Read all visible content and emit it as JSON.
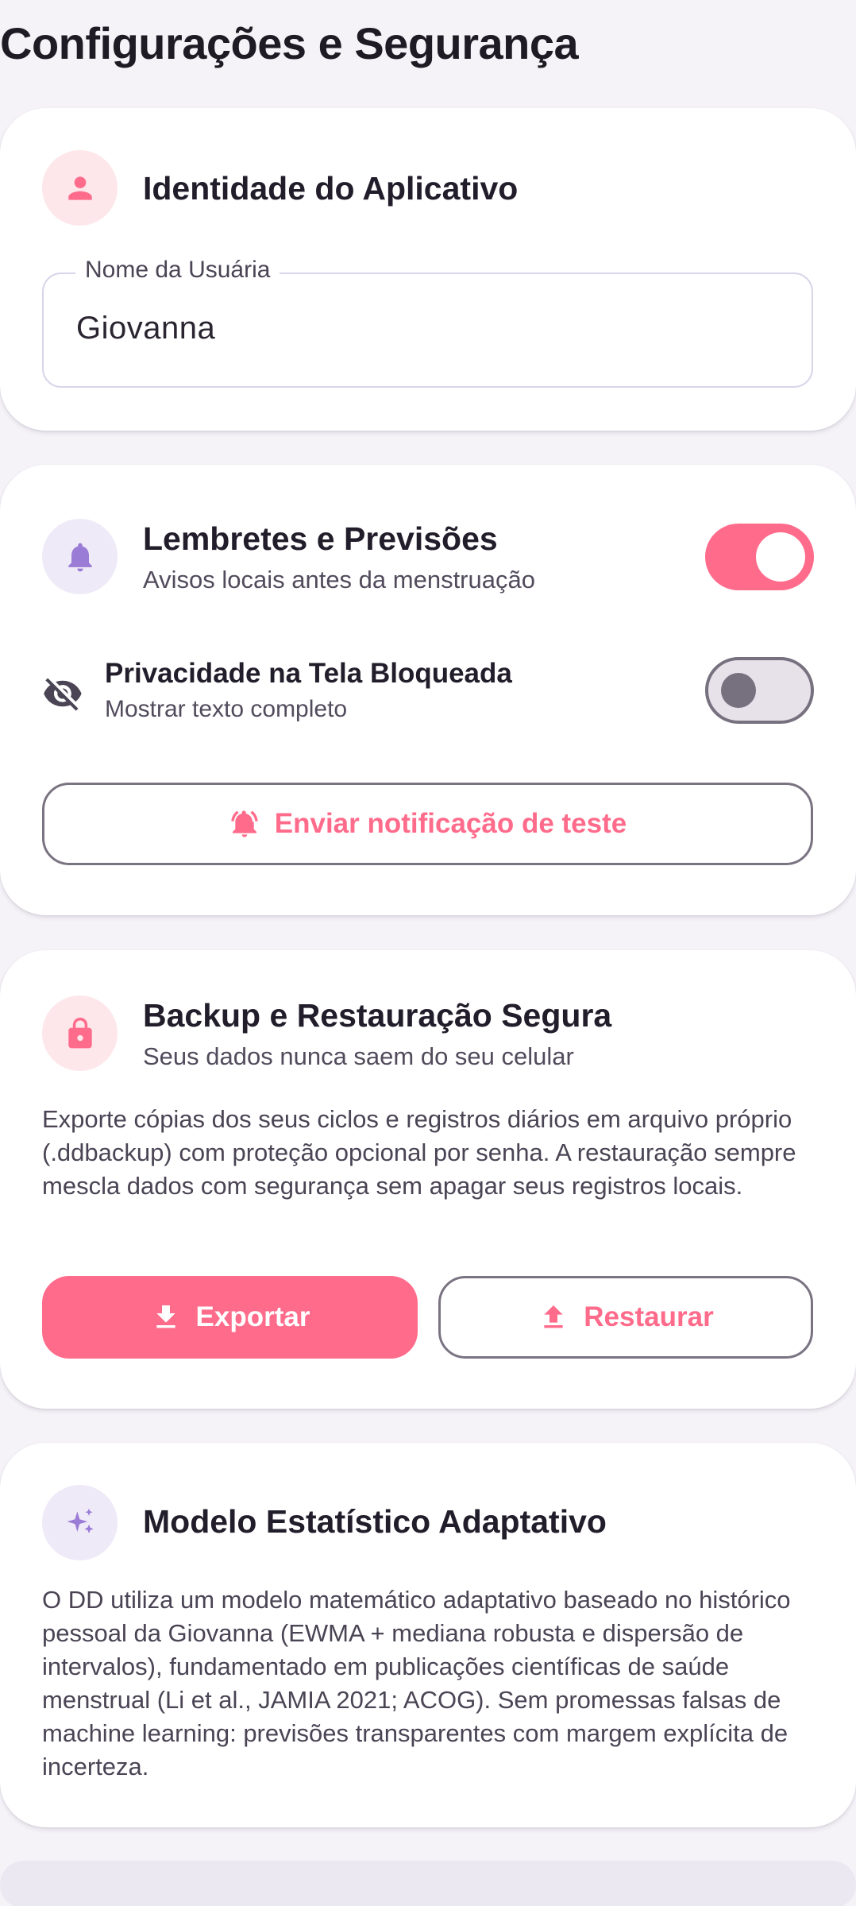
{
  "page": {
    "title": "Configurações e Segurança"
  },
  "identity": {
    "title": "Identidade do Aplicativo",
    "icon": "person-icon",
    "name_label": "Nome da Usuária",
    "name_value": "Giovanna"
  },
  "reminders": {
    "title": "Lembretes e Previsões",
    "subtitle": "Avisos locais antes da menstruação",
    "icon": "bell-icon",
    "enabled": true,
    "privacy": {
      "title": "Privacidade na Tela Bloqueada",
      "subtitle": "Mostrar texto completo",
      "icon": "eye-off-icon",
      "enabled": false
    },
    "test_button": "Enviar notificação de teste"
  },
  "backup": {
    "title": "Backup e Restauração Segura",
    "subtitle": "Seus dados nunca saem do seu celular",
    "icon": "lock-icon",
    "description": "Exporte cópias dos seus ciclos e registros diários em arquivo próprio (.ddbackup) com proteção opcional por senha. A restauração sempre mescla dados com segurança sem apagar seus registros locais.",
    "export_label": "Exportar",
    "restore_label": "Restaurar"
  },
  "model": {
    "title": "Modelo Estatístico Adaptativo",
    "icon": "sparkles-icon",
    "description": "O DD utiliza um modelo matemático adaptativo baseado no histórico pessoal da Giovanna (EWMA + mediana robusta e dispersão de intervalos), fundamentado em publicações científicas de saúde menstrual (Li et al., JAMIA 2021; ACOG). Sem promessas falsas de machine learning: previsões transparentes com margem explícita de incerteza."
  },
  "colors": {
    "accent": "#FF6B8B",
    "accent_soft": "#FDE7EB",
    "lilac": "#9A7BD6",
    "lilac_soft": "#EFEAF7",
    "background": "#F5F3F8"
  }
}
